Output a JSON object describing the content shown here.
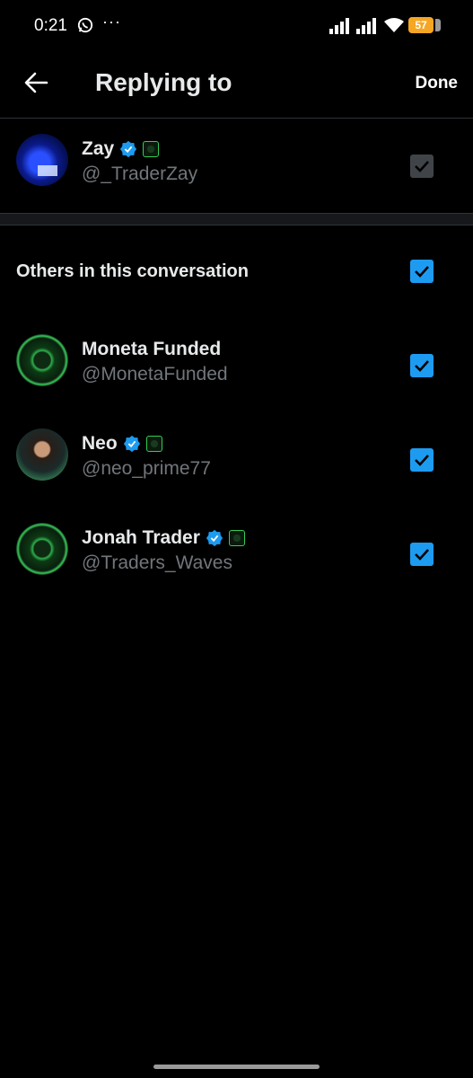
{
  "status_bar": {
    "time": "0:21",
    "more": "···",
    "battery": "57",
    "icons": [
      "whatsapp-icon",
      "signal-icon",
      "signal-icon",
      "wifi-icon",
      "battery-icon"
    ]
  },
  "header": {
    "title": "Replying to",
    "done_label": "Done",
    "back_icon": "arrow-left-icon"
  },
  "primary": {
    "name": "Zay",
    "handle": "@_TraderZay",
    "verified": true,
    "checked": true
  },
  "others": {
    "label": "Others in this conversation",
    "checked": true,
    "people": [
      {
        "name": "Moneta Funded",
        "handle": "@MonetaFunded",
        "verified": false,
        "checked": true
      },
      {
        "name": "Neo",
        "handle": "@neo_prime77",
        "verified": true,
        "checked": true
      },
      {
        "name": "Jonah Trader",
        "handle": "@Traders_Waves",
        "verified": true,
        "checked": true
      }
    ]
  },
  "colors": {
    "accent": "#1d9bf0",
    "background": "#000000",
    "secondary_text": "#71767b"
  }
}
